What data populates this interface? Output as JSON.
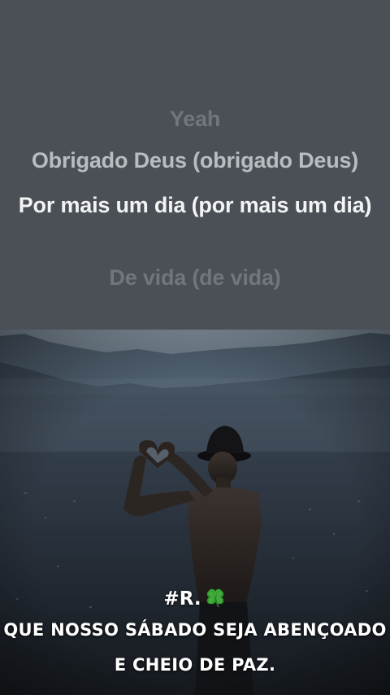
{
  "lyrics": {
    "lines": [
      "Yeah",
      "Obrigado Deus (obrigado Deus)",
      "Por mais um dia (por mais um dia)",
      "De vida (de vida)"
    ],
    "colors": {
      "panel": "#4b4f56",
      "inactive": "#72767c",
      "previous": "#b9bcc0",
      "active": "#f2f3f4"
    }
  },
  "caption": {
    "tag": "#R.",
    "icon": "four-leaf-clover-icon",
    "line1": "QUE NOSSO SÁBADO SEJA ABENÇOADO",
    "line2": "E CHEIO DE PAZ."
  }
}
